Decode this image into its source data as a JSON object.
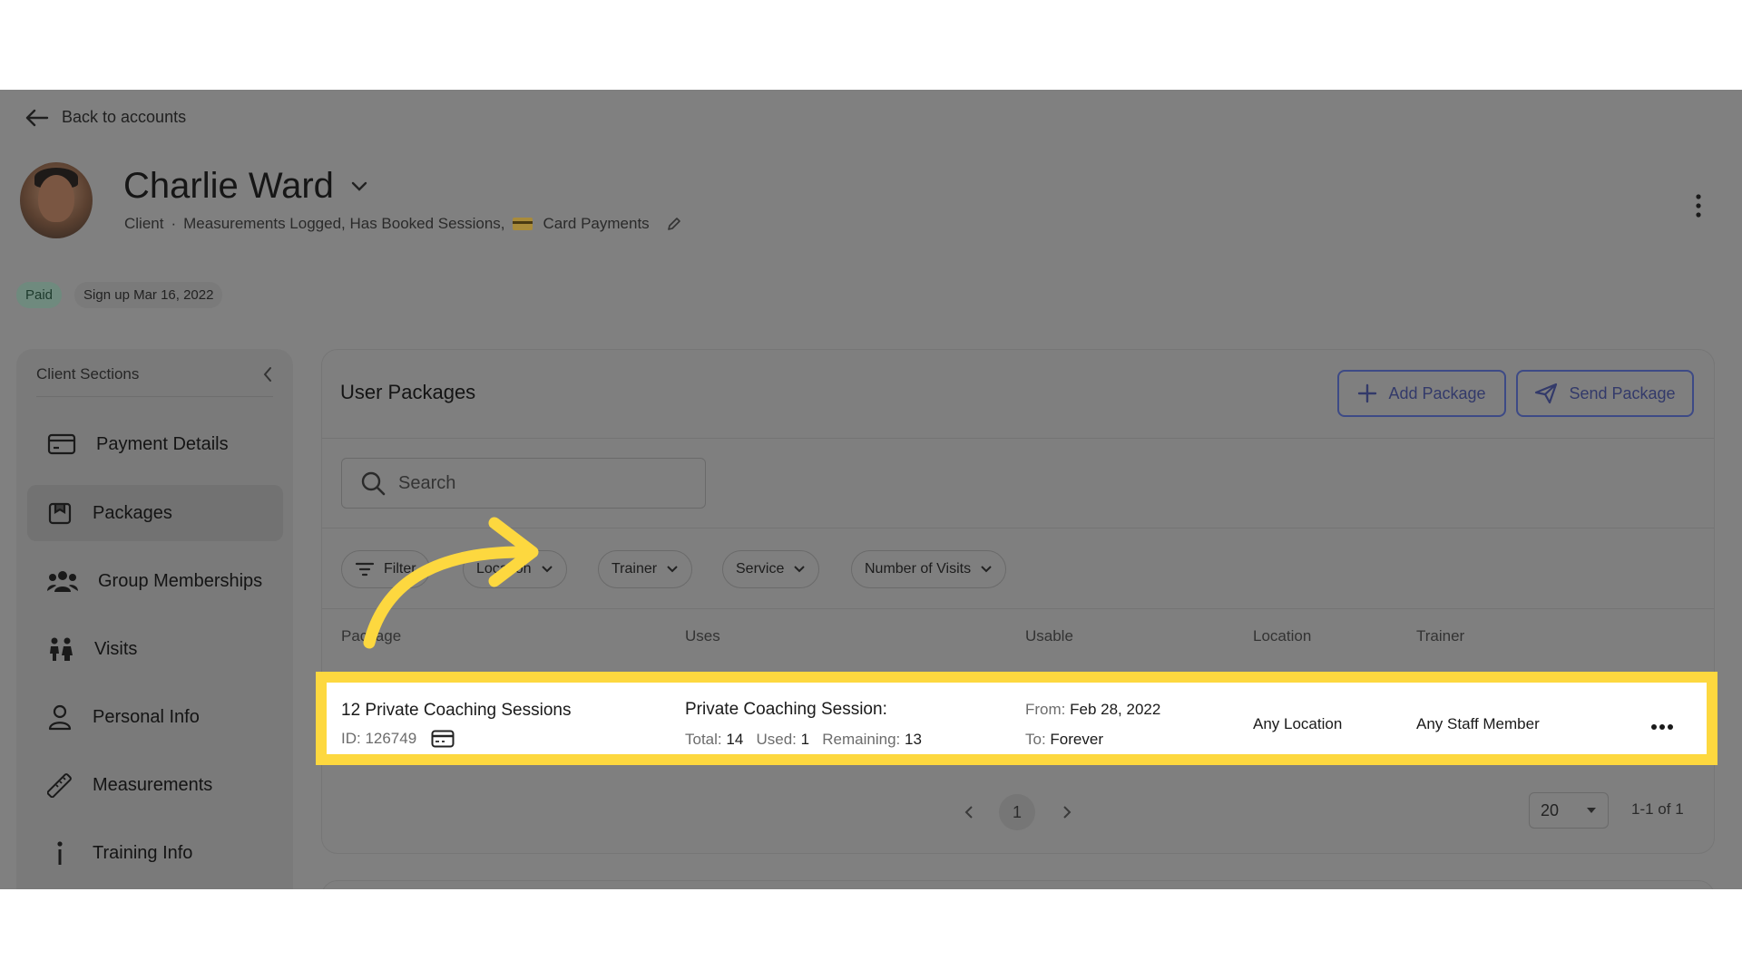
{
  "nav": {
    "back_label": "Back to accounts"
  },
  "profile": {
    "name": "Charlie Ward",
    "role": "Client",
    "separator": "·",
    "tags_text": "Measurements Logged, Has Booked Sessions,",
    "card_tag": "Card Payments"
  },
  "badges": {
    "paid": "Paid",
    "signup": "Sign up Mar 16, 2022"
  },
  "sidebar": {
    "title": "Client Sections",
    "items": [
      {
        "label": "Payment Details",
        "icon": "credit-card-icon"
      },
      {
        "label": "Packages",
        "icon": "package-icon",
        "active": true
      },
      {
        "label": "Group Memberships",
        "icon": "group-icon"
      },
      {
        "label": "Visits",
        "icon": "visits-icon"
      },
      {
        "label": "Personal Info",
        "icon": "person-icon"
      },
      {
        "label": "Measurements",
        "icon": "ruler-icon"
      },
      {
        "label": "Training Info",
        "icon": "info-icon"
      }
    ]
  },
  "panel": {
    "title": "User Packages",
    "add_label": "Add Package",
    "send_label": "Send Package",
    "search_placeholder": "Search",
    "filters": {
      "filter": "Filter",
      "location": "Location",
      "trainer": "Trainer",
      "service": "Service",
      "visits": "Number of Visits"
    },
    "columns": [
      "Package",
      "Uses",
      "Usable",
      "Location",
      "Trainer"
    ],
    "row": {
      "package_name": "12 Private Coaching Sessions",
      "package_id": "ID: 126749",
      "uses_title": "Private Coaching Session:",
      "total_label": "Total:",
      "total": "14",
      "used_label": "Used:",
      "used": "1",
      "remaining_label": "Remaining:",
      "remaining": "13",
      "from_label": "From:",
      "from": "Feb 28, 2022",
      "to_label": "To:",
      "to": "Forever",
      "location": "Any Location",
      "trainer": "Any Staff Member"
    },
    "pagination": {
      "current": "1",
      "page_size": "20",
      "range": "1-1 of 1"
    }
  },
  "colors": {
    "highlight": "#fdd83f",
    "accent": "#3d4a86"
  }
}
